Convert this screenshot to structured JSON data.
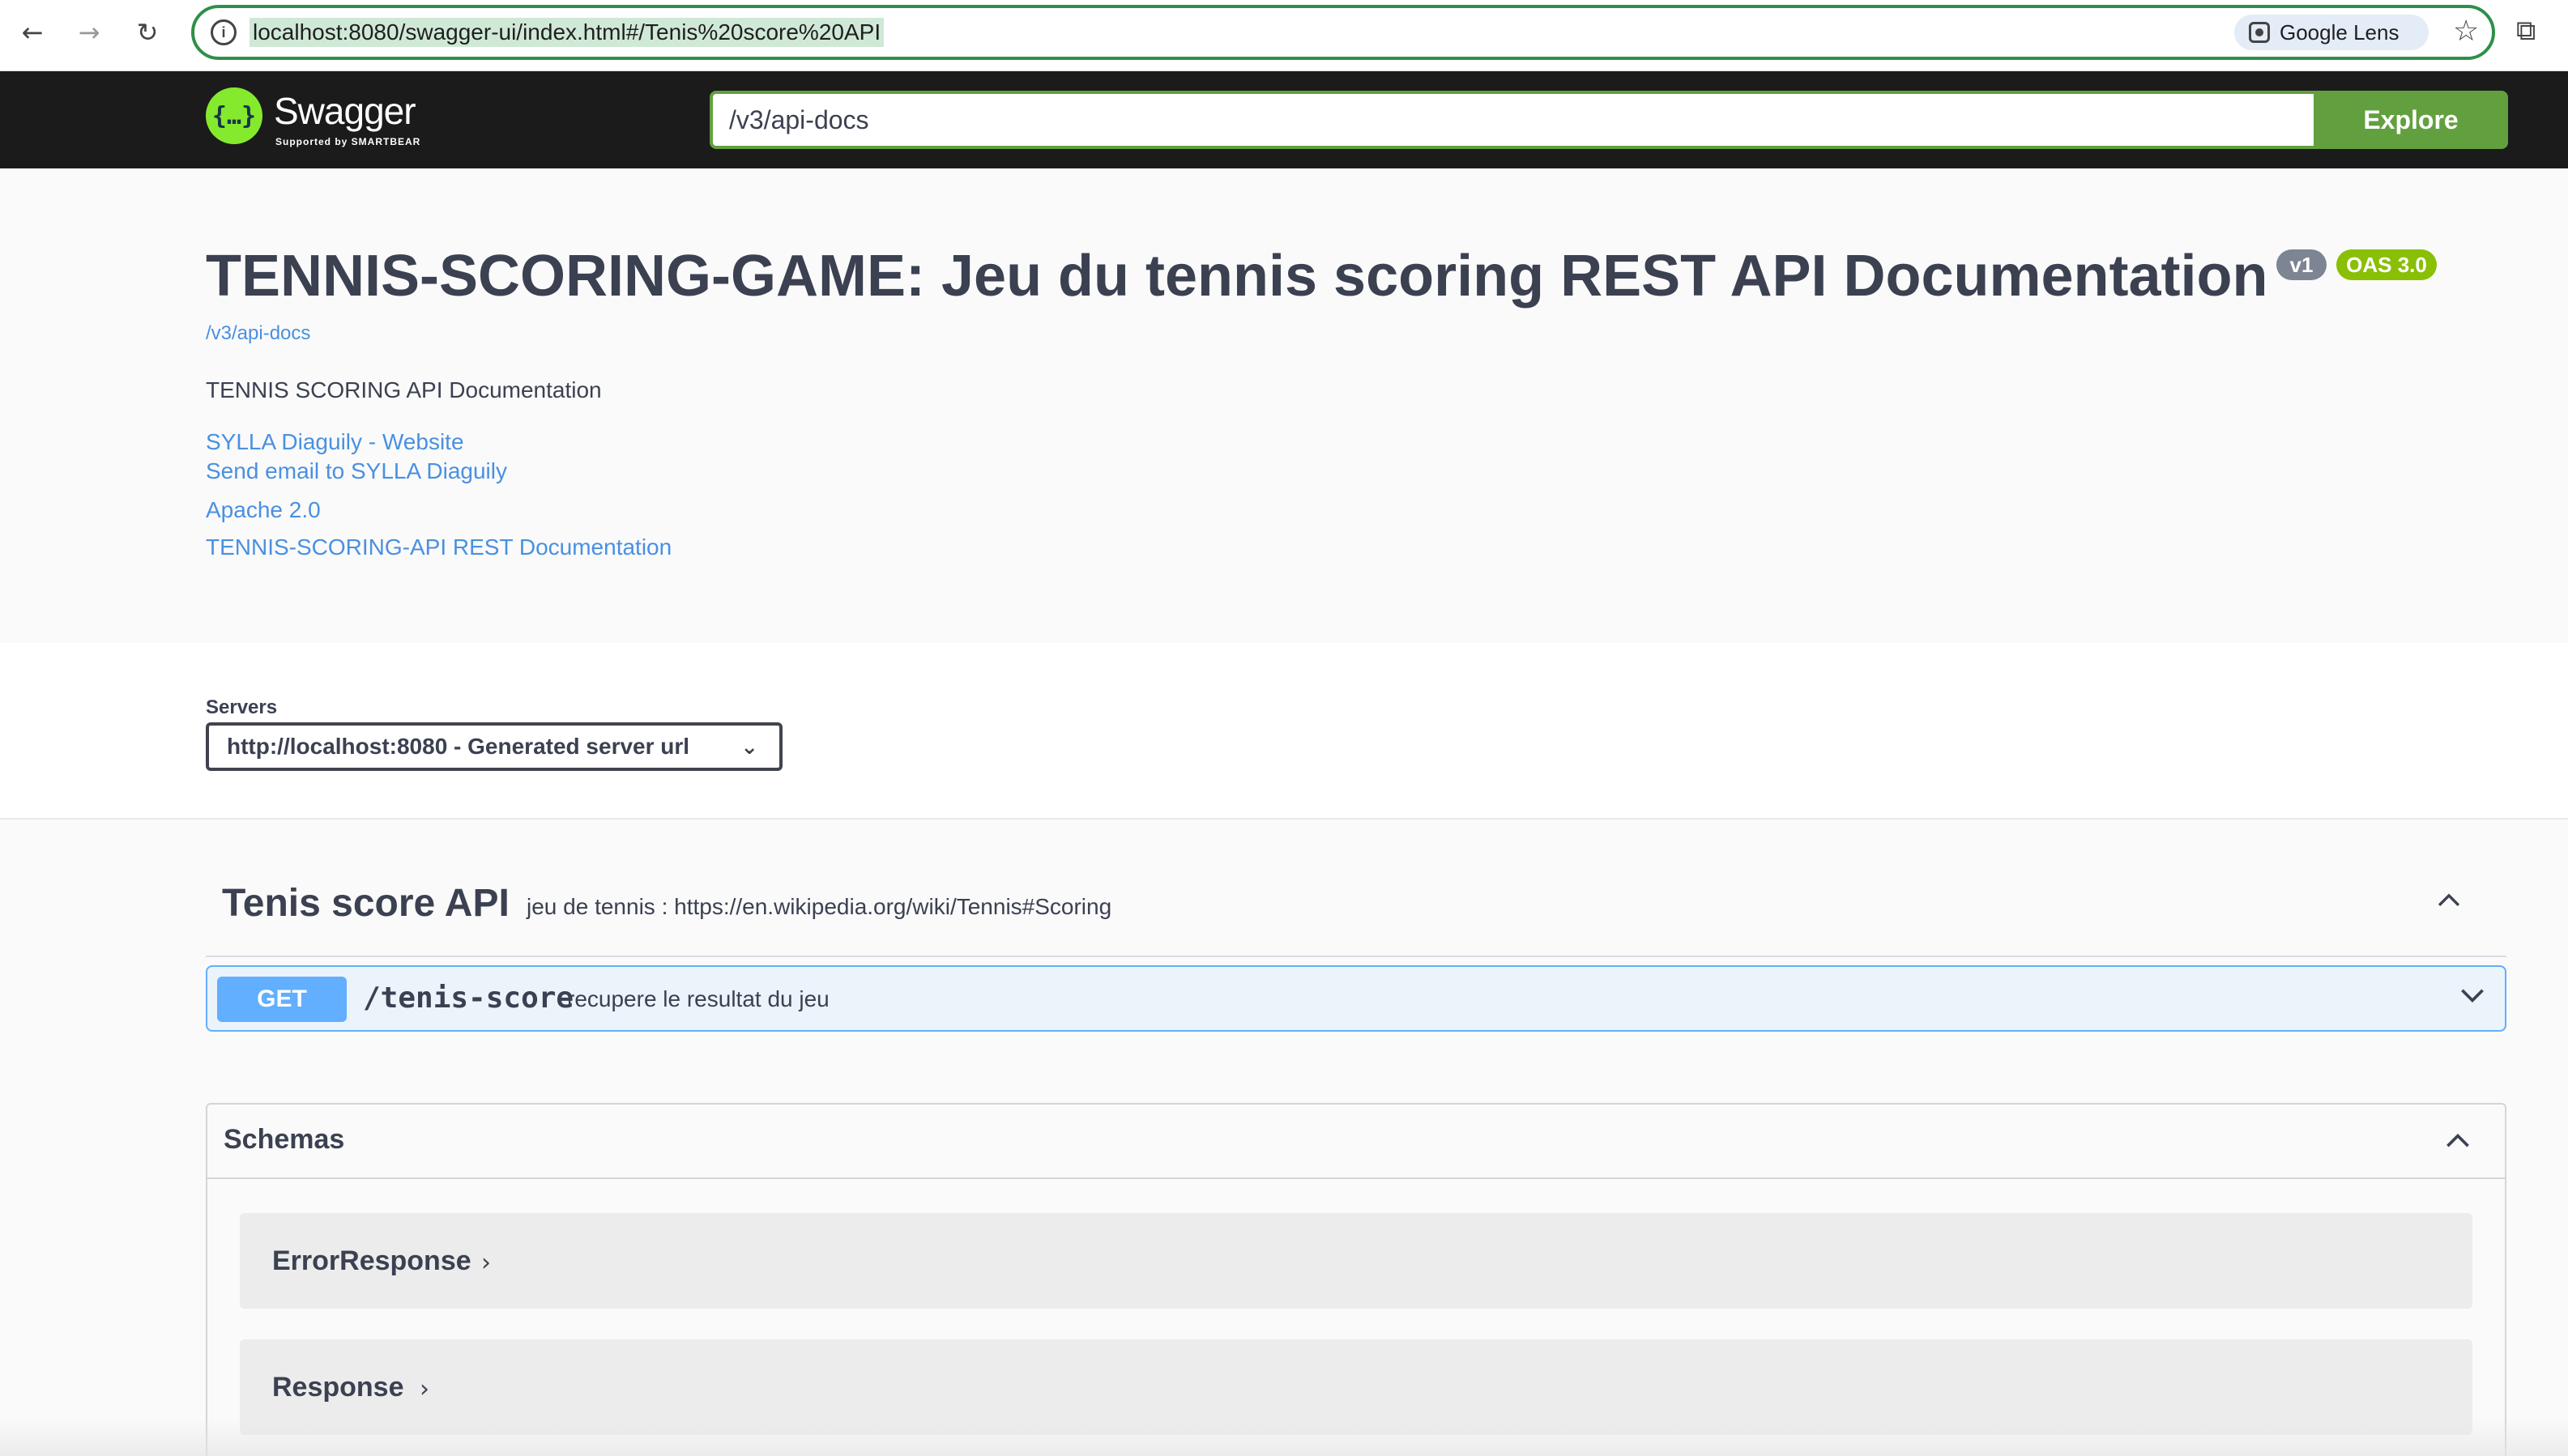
{
  "browser": {
    "url": "localhost:8080/swagger-ui/index.html#/Tenis%20score%20API",
    "lens_label": "Google Lens"
  },
  "topbar": {
    "logo_word": "Swagger",
    "logo_sub": "Supported by SMARTBEAR",
    "spec_url": "/v3/api-docs",
    "explore_label": "Explore"
  },
  "info": {
    "title": "TENNIS-SCORING-GAME: Jeu du tennis scoring REST API Documentation",
    "version_badge": "v1",
    "oas_badge": "OAS 3.0",
    "spec_link": "/v3/api-docs",
    "description": "TENNIS SCORING API Documentation",
    "links": [
      "SYLLA Diaguily - Website",
      "Send email to SYLLA Diaguily",
      "Apache 2.0",
      "TENNIS-SCORING-API REST Documentation"
    ]
  },
  "servers": {
    "label": "Servers",
    "selected": "http://localhost:8080 - Generated server url"
  },
  "tag": {
    "name": "Tenis score API",
    "description": "jeu de tennis : https://en.wikipedia.org/wiki/Tennis#Scoring",
    "operation": {
      "method": "GET",
      "path": "/tenis-score",
      "summary": "recupere le resultat du jeu"
    }
  },
  "schemas": {
    "title": "Schemas",
    "models": [
      "ErrorResponse",
      "Response"
    ]
  },
  "colors": {
    "topbar_bg": "#1b1b1b",
    "explore_green": "#62a03f",
    "get_blue": "#61affe",
    "link_blue": "#4990e2",
    "oas_badge": "#89bf04",
    "version_badge": "#7d8492"
  }
}
